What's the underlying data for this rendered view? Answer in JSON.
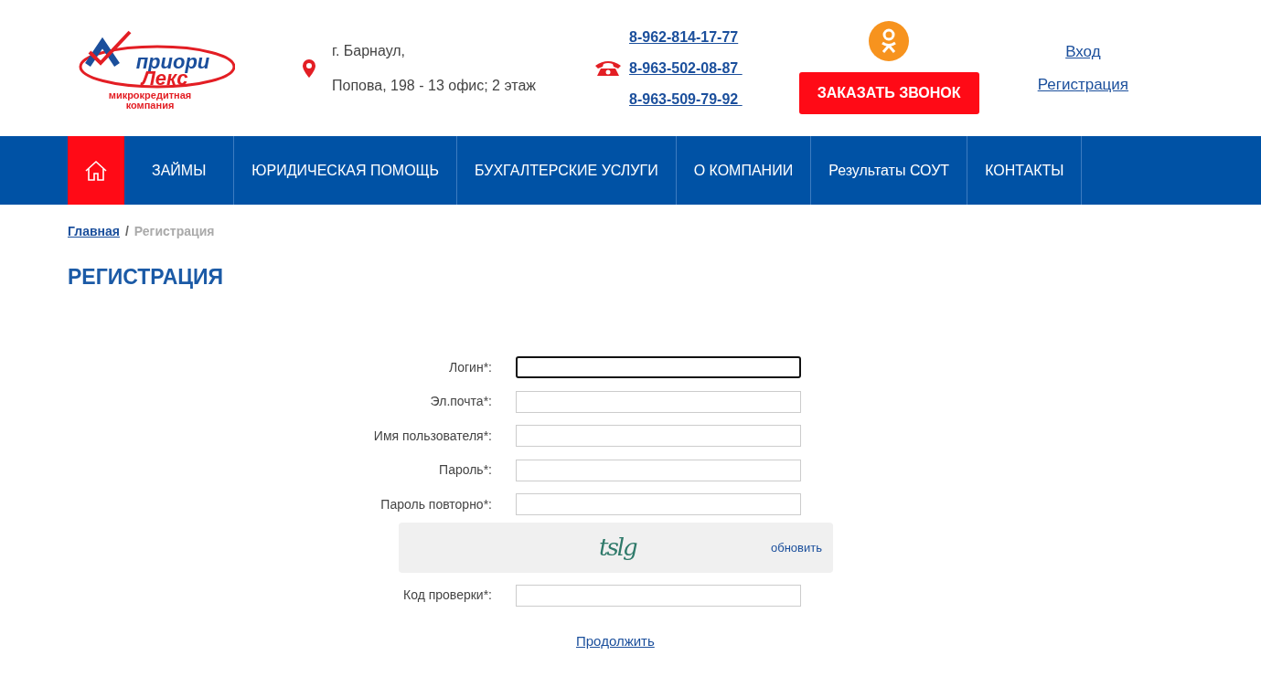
{
  "logo": {
    "line1": "приори",
    "line2": "Лекс",
    "line3": "микрокредитная",
    "line4": "компания"
  },
  "address": {
    "city": "г. Барнаул,",
    "street": "Попова, 198 - 13 офис; 2 этаж"
  },
  "phones": [
    "8-962-814-17-77",
    "8-963-502-08-87 ",
    "8-963-509-79-92 "
  ],
  "callback_button": "ЗАКАЗАТЬ ЗВОНОК",
  "auth_links": [
    "Вход",
    "Регистрация"
  ],
  "nav": [
    {
      "kind": "home",
      "selected": true
    },
    {
      "kind": "link",
      "label": "ЗАЙМЫ",
      "selected": false
    },
    {
      "kind": "link",
      "label": "ЮРИДИЧЕСКАЯ ПОМОЩЬ",
      "selected": false
    },
    {
      "kind": "link",
      "label": "БУХГАЛТЕРСКИЕ УСЛУГИ",
      "selected": false
    },
    {
      "kind": "link",
      "label": "О КОМПАНИИ",
      "selected": false
    },
    {
      "kind": "link",
      "label": "Результаты СОУТ",
      "selected": false
    },
    {
      "kind": "link",
      "label": "КОНТАКТЫ",
      "selected": false
    }
  ],
  "breadcrumbs": [
    {
      "label": "Главная",
      "link": true
    },
    {
      "label": "Регистрация",
      "link": false
    }
  ],
  "breadcrumb_separator": "/",
  "title": "РЕГИСТРАЦИЯ",
  "fields": [
    {
      "label": "Логин*:",
      "focused": true
    },
    {
      "label": "Эл.почта*:",
      "focused": false
    },
    {
      "label": "Имя пользователя*:",
      "focused": false
    },
    {
      "label": "Пароль*:",
      "focused": false
    },
    {
      "label": "Пароль повторно*:",
      "focused": false
    }
  ],
  "captcha": {
    "text": "tslg",
    "refresh": "обновить"
  },
  "code_field": {
    "label": "Код проверки*:"
  },
  "submit": "Продолжить"
}
